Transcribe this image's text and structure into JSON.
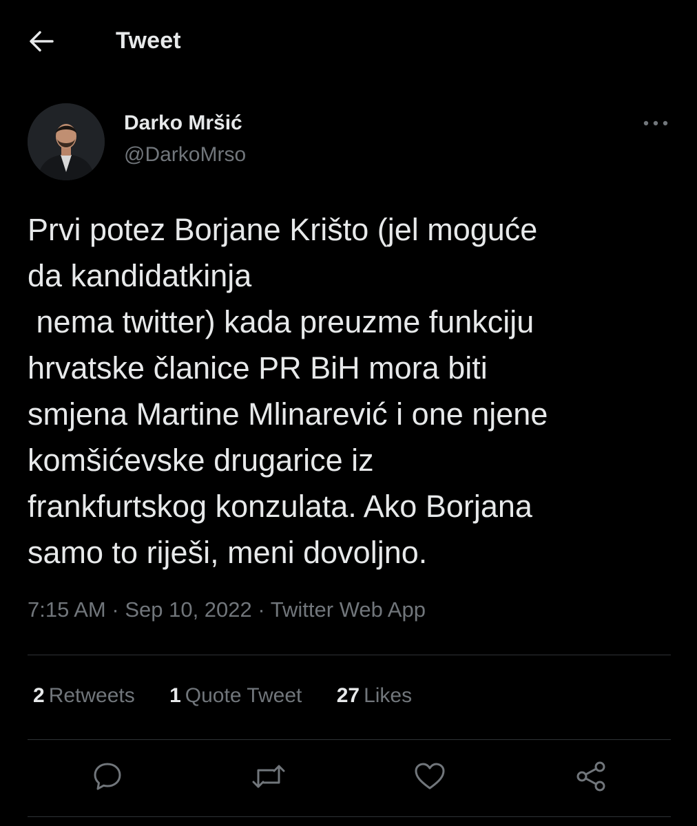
{
  "header": {
    "title": "Tweet",
    "back_icon": "arrow-left-icon"
  },
  "author": {
    "name": "Darko Mršić",
    "handle": "@DarkoMrso",
    "avatar": "avatar-photo"
  },
  "tweet": {
    "text": "Prvi potez Borjane Krišto (jel moguće\nda kandidatkinja\n nema twitter) kada preuzme funkciju\nhrvatske članice PR BiH mora biti\nsmjena Martine Mlinarević i one njene\nkomšićevske drugarice iz\nfrankfurtskog konzulata. Ako Borjana\nsamo to riješi, meni dovoljno.",
    "time": "7:15 AM",
    "separator": "·",
    "date": "Sep 10, 2022",
    "source": "Twitter Web App"
  },
  "stats": {
    "retweets_count": "2",
    "retweets_label": "Retweets",
    "quotes_count": "1",
    "quotes_label": "Quote Tweet",
    "likes_count": "27",
    "likes_label": "Likes"
  },
  "actions": [
    "reply-icon",
    "retweet-icon",
    "like-icon",
    "share-icon"
  ],
  "colors": {
    "background": "#000000",
    "text_primary": "#e7e9ea",
    "text_secondary": "#71767b",
    "divider": "#2f3336"
  }
}
